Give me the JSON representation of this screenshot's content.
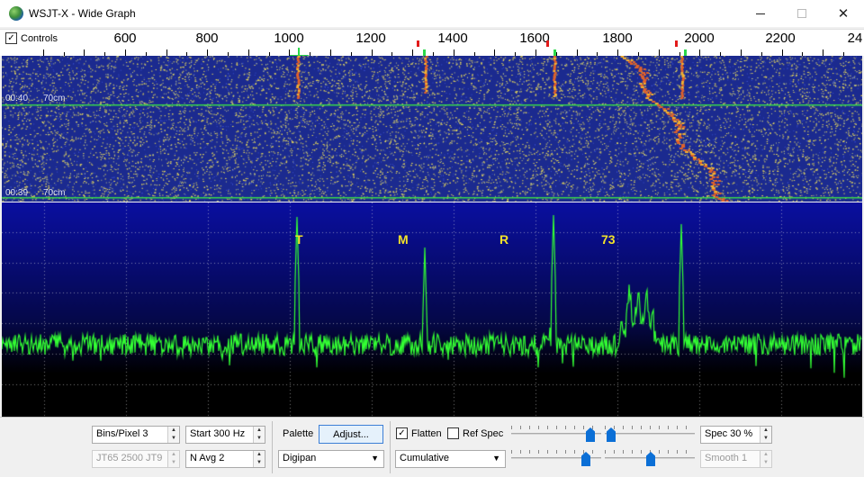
{
  "window": {
    "title": "WSJT-X - Wide Graph"
  },
  "scale": {
    "controls_label": "Controls",
    "controls_checked": true,
    "labels": [
      "600",
      "800",
      "1000",
      "1200",
      "1400",
      "1600",
      "1800",
      "2000",
      "2200",
      "24"
    ]
  },
  "waterfall": {
    "timestamp_upper": "00:40",
    "band_upper": "70cm",
    "timestamp_lower": "00:39",
    "band_lower": "70cm"
  },
  "spectrum": {
    "letters": [
      "T",
      "M",
      "R",
      "73"
    ]
  },
  "controls": {
    "bins_pixel": "Bins/Pixel  3",
    "start": "Start 300 Hz",
    "mode_info": "JT65   2500   JT9",
    "n_avg": "N Avg 2",
    "palette_label": "Palette",
    "adjust_label": "Adjust...",
    "palette_value": "Digipan",
    "flatten_label": "Flatten",
    "flatten_checked": true,
    "ref_spec_label": "Ref Spec",
    "ref_spec_checked": false,
    "spectrum_mode": "Cumulative",
    "spec_value": "Spec 30 %",
    "smooth_value": "Smooth  1"
  },
  "colors": {
    "waterfall_bg": "#1b2a8f",
    "waterfall_speck": "#e6d75a",
    "signal_trace": "#e0622a",
    "spectrum_trace": "#33ff33",
    "timeline_green": "#39d84a",
    "letter_yellow": "#f2e22a",
    "marker_red": "#e21a1a",
    "marker_green": "#2bd84a",
    "accent_blue": "#0b6fd6"
  }
}
